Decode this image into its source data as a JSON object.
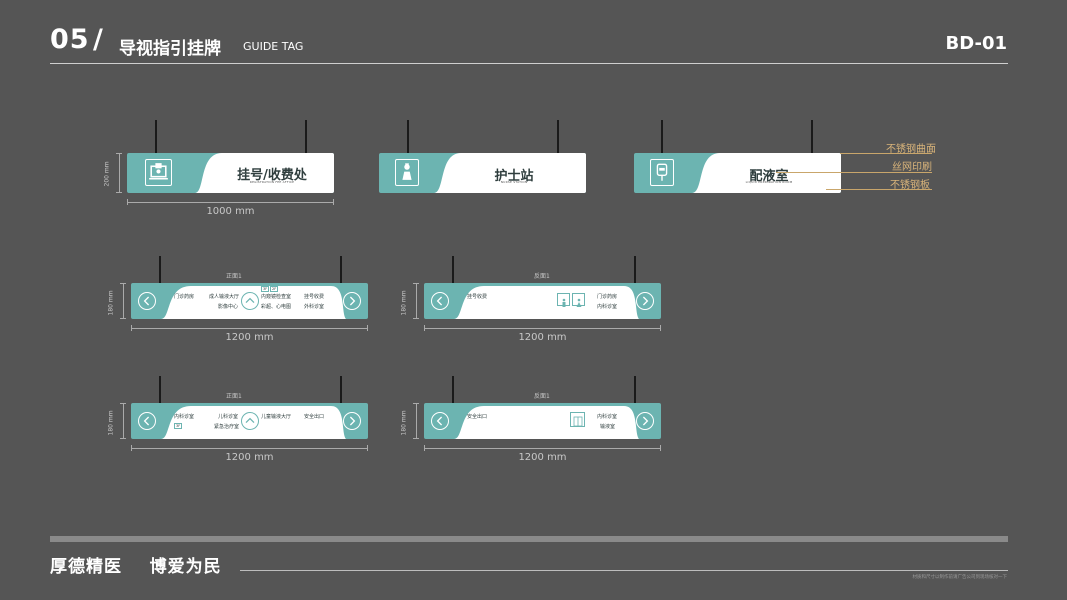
{
  "header": {
    "number": "05",
    "slash": "/",
    "title": "导视指引挂牌",
    "subtitle": "GUIDE TAG",
    "code": "BD-01"
  },
  "row1": {
    "signs": [
      {
        "title": "挂号/收费处",
        "en": "REGISTRATION FEE AFFICE",
        "icon": "registration-payment-icon"
      },
      {
        "title": "护士站",
        "en": "NURSE STATION",
        "icon": "nurse-icon"
      },
      {
        "title": "配液室",
        "en": "LIQUID PREPARATION ROOM",
        "icon": "iv-bag-icon"
      }
    ],
    "height_label": "200 mm",
    "width_label": "1000 mm",
    "materials": [
      "不锈钢曲面",
      "丝网印刷",
      "不锈钢板"
    ]
  },
  "row2": {
    "left": {
      "face_label": "正面1",
      "items": [
        "门诊药房",
        "成人输液大厅",
        "影像中心",
        "内窥镜检查室",
        "彩超、心电图",
        "挂号收费",
        "外科诊室"
      ],
      "tags": [
        "3F",
        "2F"
      ],
      "height_label": "180 mm",
      "width_label": "1200 mm"
    },
    "right": {
      "face_label": "反面1",
      "items": [
        "挂号收费",
        "门诊药房",
        "内科诊室"
      ],
      "height_label": "180 mm",
      "width_label": "1200 mm"
    }
  },
  "row3": {
    "left": {
      "face_label": "正面1",
      "items": [
        "内科诊室",
        "儿科诊室",
        "紧急治疗室",
        "儿童输液大厅",
        "安全出口"
      ],
      "tags": [
        "3F"
      ],
      "height_label": "180 mm",
      "width_label": "1200 mm"
    },
    "right": {
      "face_label": "反面1",
      "items": [
        "安全出口",
        "内科诊室",
        "输液室"
      ],
      "height_label": "180 mm",
      "width_label": "1200 mm"
    }
  },
  "footer": {
    "slogan": "厚德精医    博爱为民",
    "note": "材质和尺寸以制作前请广告公司到现场核对一下"
  },
  "colors": {
    "background": "#555555",
    "accent_teal": "#6cb4b1",
    "material_gold": "#d9b47a"
  }
}
